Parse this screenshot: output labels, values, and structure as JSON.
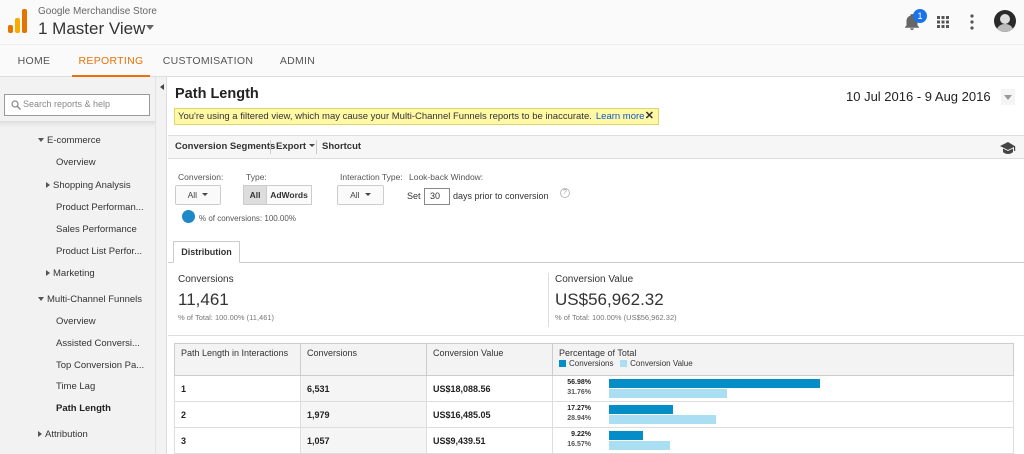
{
  "header": {
    "store_name": "Google Merchandise Store",
    "view_name": "1 Master View",
    "notification_count": "1",
    "icons": [
      "bell-icon",
      "apps-grid-icon",
      "more-vert-icon",
      "avatar"
    ]
  },
  "nav": {
    "tabs": [
      {
        "label": "HOME",
        "active": false
      },
      {
        "label": "REPORTING",
        "active": true
      },
      {
        "label": "CUSTOMISATION",
        "active": false
      },
      {
        "label": "ADMIN",
        "active": false
      }
    ]
  },
  "sidebar": {
    "search_placeholder": "Search reports & help",
    "items": [
      {
        "label": "E-commerce",
        "expander": "down"
      },
      {
        "label": "Overview"
      },
      {
        "label": "Shopping Analysis",
        "expander": "right"
      },
      {
        "label": "Product Performan..."
      },
      {
        "label": "Sales Performance"
      },
      {
        "label": "Product List Perfor..."
      },
      {
        "label": "Marketing",
        "expander": "right"
      },
      {
        "label": "Multi-Channel Funnels",
        "expander": "down"
      },
      {
        "label": "Overview"
      },
      {
        "label": "Assisted Conversi..."
      },
      {
        "label": "Top Conversion Pa..."
      },
      {
        "label": "Time Lag"
      },
      {
        "label": "Path Length",
        "current": true
      },
      {
        "label": "Attribution",
        "expander": "right"
      }
    ]
  },
  "report": {
    "title": "Path Length",
    "notice_text": "You're using a filtered view, which may cause your Multi-Channel Funnels reports to be inaccurate.",
    "notice_link": "Learn more",
    "notice_close": "✕",
    "date_range": "10 Jul 2016 - 9 Aug 2016"
  },
  "toolbar": {
    "conversion_segments": "Conversion Segments",
    "export": "Export",
    "shortcut": "Shortcut"
  },
  "filters": {
    "conversion_label": "Conversion:",
    "conversion_value": "All",
    "type_label": "Type:",
    "type_all": "All",
    "type_adwords": "AdWords",
    "interaction_label": "Interaction Type:",
    "interaction_value": "All",
    "lookback_label": "Look-back Window:",
    "lookback_prefix": "Set",
    "lookback_days": "30",
    "lookback_suffix": "days prior to conversion",
    "help": "?",
    "pct_conversions": "% of conversions: 100.00%"
  },
  "distribution_tab": "Distribution",
  "scorecards": {
    "conversions": {
      "title": "Conversions",
      "value": "11,461",
      "sub": "% of Total: 100.00% (11,461)"
    },
    "conversion_value": {
      "title": "Conversion Value",
      "value": "US$56,962.32",
      "sub": "% of Total: 100.00% (US$56,962.32)"
    }
  },
  "table": {
    "headers": [
      "Path Length in Interactions",
      "Conversions",
      "Conversion Value",
      "Percentage of Total"
    ],
    "legend": [
      {
        "name": "Conversions",
        "color": "#058dc7"
      },
      {
        "name": "Conversion Value",
        "color": "#aadff3"
      }
    ],
    "rows": [
      {
        "path_length": "1",
        "conversions": "6,531",
        "value": "US$18,088.56",
        "pct_conv": "56.98%",
        "pct_value": "31.76%",
        "conv_frac": 0.5698,
        "value_frac": 0.3176
      },
      {
        "path_length": "2",
        "conversions": "1,979",
        "value": "US$16,485.05",
        "pct_conv": "17.27%",
        "pct_value": "28.94%",
        "conv_frac": 0.1727,
        "value_frac": 0.2894
      },
      {
        "path_length": "3",
        "conversions": "1,057",
        "value": "US$9,439.51",
        "pct_conv": "9.22%",
        "pct_value": "16.57%",
        "conv_frac": 0.0922,
        "value_frac": 0.1657
      }
    ]
  }
}
